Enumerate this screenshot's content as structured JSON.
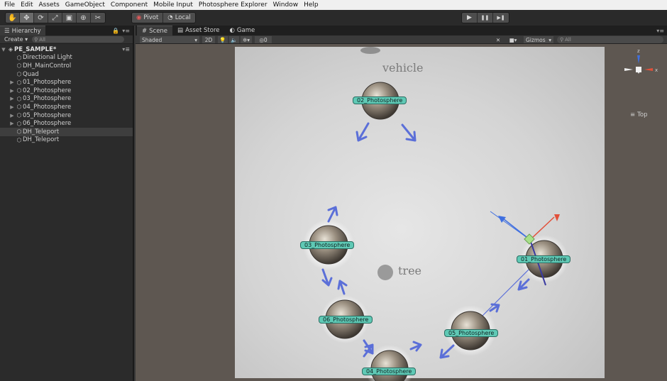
{
  "menu": [
    "File",
    "Edit",
    "Assets",
    "GameObject",
    "Component",
    "Mobile Input",
    "Photosphere Explorer",
    "Window",
    "Help"
  ],
  "toolbar": {
    "tools": [
      {
        "name": "hand-tool",
        "icon": "✋"
      },
      {
        "name": "move-tool",
        "icon": "✥"
      },
      {
        "name": "rotate-tool",
        "icon": "⟳"
      },
      {
        "name": "scale-tool",
        "icon": "⤢"
      },
      {
        "name": "rect-tool",
        "icon": "▣"
      },
      {
        "name": "transform-tool",
        "icon": "⊕"
      },
      {
        "name": "custom-tool",
        "icon": "✂"
      }
    ],
    "pivot_label": "Pivot",
    "local_label": "Local",
    "play_icon": "▶",
    "pause_icon": "❚❚",
    "step_icon": "▶❚"
  },
  "hierarchy": {
    "tab_label": "Hierarchy",
    "create_label": "Create",
    "search_placeholder": "All",
    "scene_name": "PE_SAMPLE*",
    "items": [
      {
        "label": "Directional Light",
        "has_children": false,
        "selected": false
      },
      {
        "label": "DH_MainControl",
        "has_children": false,
        "selected": false
      },
      {
        "label": "Quad",
        "has_children": false,
        "selected": false
      },
      {
        "label": "01_Photosphere",
        "has_children": true,
        "selected": false
      },
      {
        "label": "02_Photosphere",
        "has_children": true,
        "selected": false
      },
      {
        "label": "03_Photosphere",
        "has_children": true,
        "selected": false
      },
      {
        "label": "04_Photosphere",
        "has_children": true,
        "selected": false
      },
      {
        "label": "05_Photosphere",
        "has_children": true,
        "selected": false
      },
      {
        "label": "06_Photosphere",
        "has_children": true,
        "selected": false
      },
      {
        "label": "DH_Teleport",
        "has_children": false,
        "selected": true
      },
      {
        "label": "DH_Teleport",
        "has_children": false,
        "selected": false
      }
    ]
  },
  "scene": {
    "tabs": [
      {
        "label": "Scene",
        "icon": "#",
        "active": true
      },
      {
        "label": "Asset Store",
        "icon": "▤",
        "active": false
      },
      {
        "label": "Game",
        "icon": "◐",
        "active": false
      }
    ],
    "shading_mode": "Shaded",
    "mode_2d_label": "2D",
    "effects_count": "0",
    "gizmos_label": "Gizmos",
    "search_placeholder": "All",
    "view_label": "Top",
    "map_labels": {
      "vehicle": "vehicle",
      "tree": "tree"
    },
    "spheres": [
      {
        "id": "02",
        "label": "02_Photosphere"
      },
      {
        "id": "03",
        "label": "03_Photosphere"
      },
      {
        "id": "01",
        "label": "01_Photosphere"
      },
      {
        "id": "06",
        "label": "06_Photosphere"
      },
      {
        "id": "05",
        "label": "05_Photosphere"
      },
      {
        "id": "04",
        "label": "04_Photosphere"
      }
    ],
    "colors": {
      "label_bg": "#5fc9b5",
      "arrow": "#5b6fd8",
      "gizmo_x": "#e2503a",
      "gizmo_y": "#7bc86a",
      "gizmo_z": "#3f6fe0"
    }
  }
}
